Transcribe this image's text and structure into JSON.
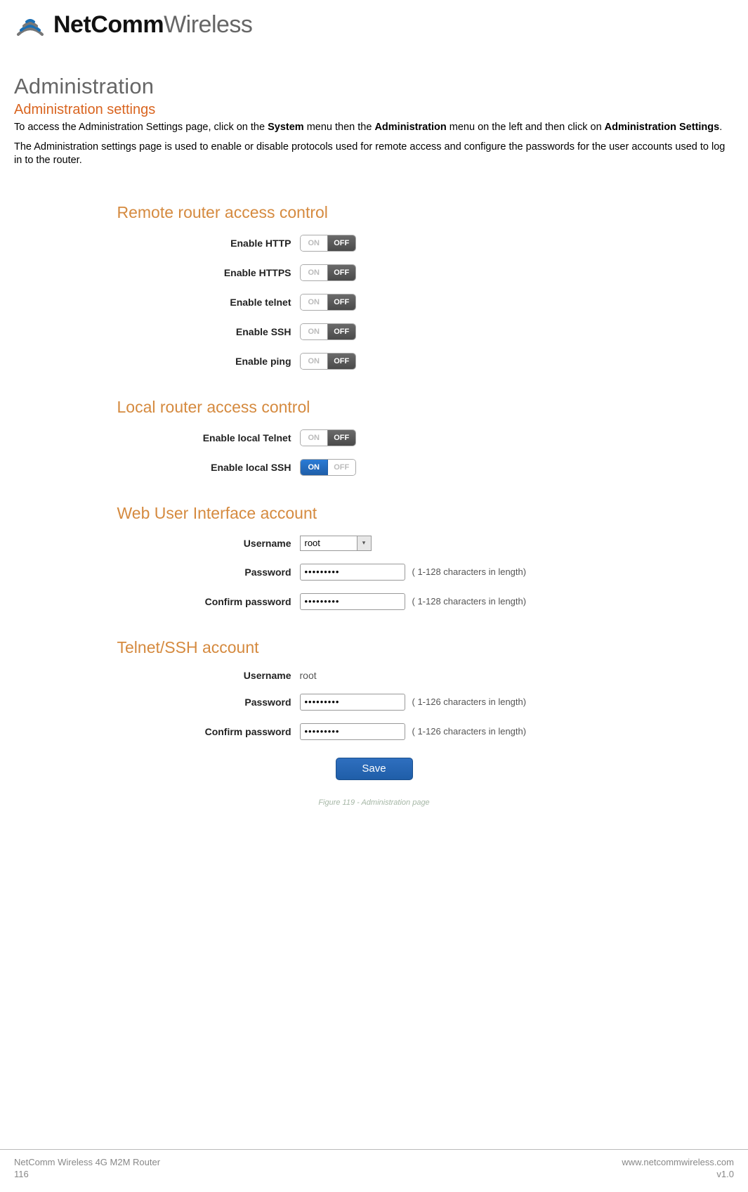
{
  "logo": {
    "bold": "NetComm",
    "light": "Wireless"
  },
  "heading": "Administration",
  "subheading": "Administration settings",
  "para1_pre": "To access the Administration Settings page, click on the ",
  "para1_b1": "System",
  "para1_mid1": " menu then the ",
  "para1_b2": "Administration",
  "para1_mid2": " menu on the left and then click on ",
  "para1_b3": "Administration Settings",
  "para1_end": ".",
  "para2": "The Administration settings page is used to enable or disable protocols used for remote access and configure the passwords for the user accounts used to log in to the router.",
  "sections": {
    "remote": {
      "title": "Remote router access control",
      "rows": [
        {
          "label": "Enable HTTP",
          "state": "off"
        },
        {
          "label": "Enable HTTPS",
          "state": "off"
        },
        {
          "label": "Enable telnet",
          "state": "off"
        },
        {
          "label": "Enable SSH",
          "state": "off"
        },
        {
          "label": "Enable ping",
          "state": "off"
        }
      ]
    },
    "local": {
      "title": "Local router access control",
      "rows": [
        {
          "label": "Enable local Telnet",
          "state": "off"
        },
        {
          "label": "Enable local SSH",
          "state": "on"
        }
      ]
    },
    "web": {
      "title": "Web User Interface account",
      "username_label": "Username",
      "username_value": "root",
      "password_label": "Password",
      "password_value": "•••••••••",
      "password_hint": "( 1-128 characters in length)",
      "confirm_label": "Confirm password",
      "confirm_value": "•••••••••",
      "confirm_hint": "( 1-128 characters in length)"
    },
    "ssh": {
      "title": "Telnet/SSH account",
      "username_label": "Username",
      "username_value": "root",
      "password_label": "Password",
      "password_value": "•••••••••",
      "password_hint": "( 1-126 characters in length)",
      "confirm_label": "Confirm password",
      "confirm_value": "•••••••••",
      "confirm_hint": "( 1-126 characters in length)"
    }
  },
  "toggle": {
    "on": "ON",
    "off": "OFF"
  },
  "save_label": "Save",
  "figure_caption": "Figure 119 - Administration page",
  "footer": {
    "product": "NetComm Wireless 4G M2M Router",
    "page": "116",
    "url": "www.netcommwireless.com",
    "version": "v1.0"
  }
}
